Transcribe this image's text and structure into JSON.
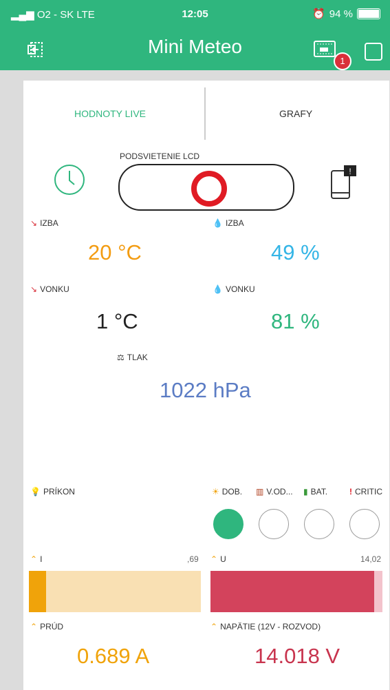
{
  "status": {
    "carrier": "O2 - SK  LTE",
    "time": "12:05",
    "battery": "94 %",
    "battery_level": 0.94
  },
  "app": {
    "title": "Mini Meteo",
    "badge": "1"
  },
  "tabs": [
    "HODNOTY LIVE",
    "GRAFY"
  ],
  "lcd": {
    "label": "PODSVIETENIE LCD"
  },
  "sensors": {
    "izba_temp": {
      "label": "IZBA",
      "value": "20 °C",
      "color": "#f39c12"
    },
    "izba_hum": {
      "label": "IZBA",
      "value": "49 %",
      "color": "#34b5e6"
    },
    "vonku_temp": {
      "label": "VONKU",
      "value": "1 °C",
      "color": "#222222"
    },
    "vonku_hum": {
      "label": "VONKU",
      "value": "81 %",
      "color": "#2fb67e"
    },
    "tlak": {
      "label": "TLAK",
      "value": "1022 hPa",
      "color": "#5b7cc4"
    }
  },
  "prikon": {
    "label": "PRÍKON"
  },
  "indicators": [
    {
      "label": "DOB.",
      "on": true
    },
    {
      "label": "V.OD...",
      "on": false
    },
    {
      "label": "BAT.",
      "on": false
    },
    {
      "label": "CRITIC",
      "on": false
    }
  ],
  "current_bar": {
    "label": "I",
    "max": ",69",
    "level": 0.1,
    "color": "#f0a30a",
    "bg": "#f9e0b3"
  },
  "voltage_bar": {
    "label": "U",
    "max": "14,02",
    "level": 0.95,
    "color": "#d3435c",
    "bg": "#f3c3cc"
  },
  "prud": {
    "label": "PRÚD",
    "value": "0.689 A",
    "color": "#f0a30a"
  },
  "napatie": {
    "label": "NAPÄTIE (12V - ROZVOD)",
    "value": "14.018 V",
    "color": "#c8344e"
  }
}
